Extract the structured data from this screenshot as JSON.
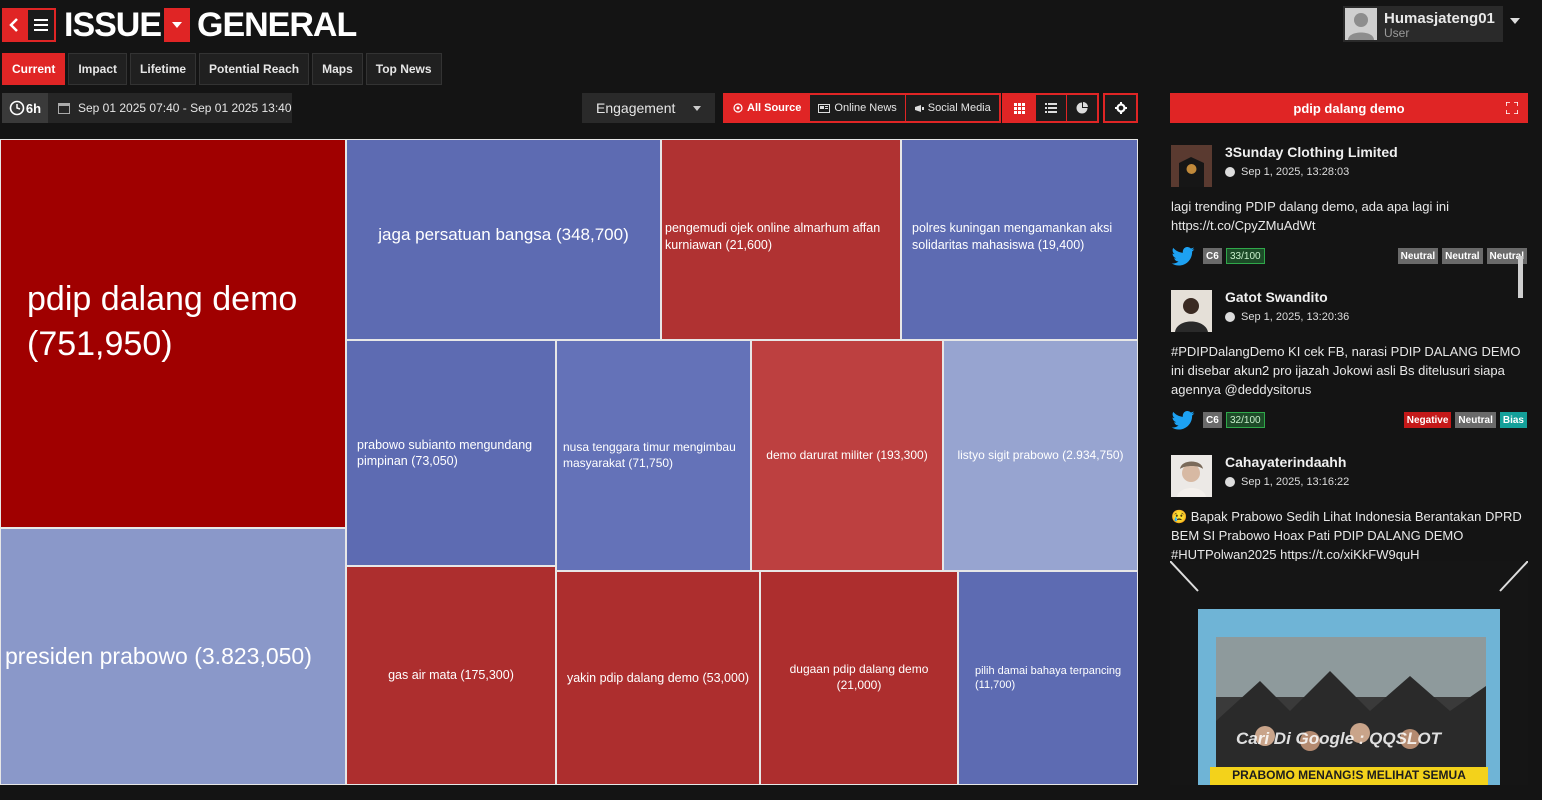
{
  "header": {
    "title": "ISSUE",
    "issue_name": "GENERAL",
    "user": {
      "name": "Humasjateng01",
      "role": "User"
    }
  },
  "tabs": [
    {
      "label": "Current",
      "active": true
    },
    {
      "label": "Impact"
    },
    {
      "label": "Lifetime"
    },
    {
      "label": "Potential Reach"
    },
    {
      "label": "Maps"
    },
    {
      "label": "Top News"
    }
  ],
  "filters": {
    "period": "6h",
    "date_range": "Sep 01 2025 07:40  - Sep 01 2025 13:40",
    "metric": "Engagement",
    "sources": [
      {
        "label": "All Source",
        "icon": "target-icon",
        "active": true
      },
      {
        "label": "Online News",
        "icon": "newspaper-icon"
      },
      {
        "label": "Social Media",
        "icon": "social-icon"
      }
    ]
  },
  "treemap": {
    "tiles": [
      {
        "label": "pdip dalang demo (751,950)",
        "color": "#a00000"
      },
      {
        "label": "presiden prabowo (3.823,050)",
        "color": "#8a98c9"
      },
      {
        "label": "jaga persatuan bangsa (348,700)",
        "color": "#5d6bb2"
      },
      {
        "label": "pengemudi ojek online almarhum affan kurniawan (21,600)",
        "color": "#b03232"
      },
      {
        "label": "polres kuningan mengamankan aksi solidaritas mahasiswa (19,400)",
        "color": "#5d6bb2"
      },
      {
        "label": "prabowo subianto mengundang pimpinan (73,050)",
        "color": "#5d6bb2"
      },
      {
        "label": "nusa tenggara timur mengimbau masyarakat (71,750)",
        "color": "#5d6bb2"
      },
      {
        "label": "demo darurat militer (193,300)",
        "color": "#bd4040"
      },
      {
        "label": "listyo sigit prabowo (2.934,750)",
        "color": "#97a4d0"
      },
      {
        "label": "gas air mata (175,300)",
        "color": "#ad2e2e"
      },
      {
        "label": "yakin pdip dalang demo (53,000)",
        "color": "#ad2e2e"
      },
      {
        "label": "dugaan pdip dalang demo (21,000)",
        "color": "#ad2e2e"
      },
      {
        "label": "pilih damai bahaya terpancing (11,700)",
        "color": "#5d6bb2"
      }
    ]
  },
  "news_panel": {
    "title": "pdip dalang demo",
    "posts": [
      {
        "author": "3Sunday Clothing Limited",
        "time": "Sep 1, 2025, 13:28:03",
        "text": "lagi trending PDIP dalang demo, ada apa lagi ini https://t.co/CpyZMuAdWt",
        "channel": "C6",
        "score": "33/100",
        "sentiments": [
          "Neutral",
          "Neutral",
          "Neutral"
        ]
      },
      {
        "author": "Gatot Swandito",
        "time": "Sep 1, 2025, 13:20:36",
        "text": "#PDIPDalangDemo KI cek FB, narasi PDIP DALANG DEMO ini disebar akun2 pro ijazah Jokowi asli Bs ditelusuri siapa agennya @deddysitorus",
        "channel": "C6",
        "score": "32/100",
        "sentiments": [
          "Negative",
          "Neutral",
          "Bias"
        ]
      },
      {
        "author": "Cahayaterindaahh",
        "time": "Sep 1, 2025, 13:16:22",
        "text": "😢 Bapak Prabowo Sedih Lihat Indonesia Berantakan DPRD BEM SI Prabowo Hoax Pati PDIP DALANG DEMO #HUTPolwan2025 https://t.co/xiKkFW9quH",
        "media_overlay": "Cari Di Google : QQSLOT",
        "media_caption": "PRABOMO MENANG!S MELIHAT SEMUA"
      }
    ]
  }
}
